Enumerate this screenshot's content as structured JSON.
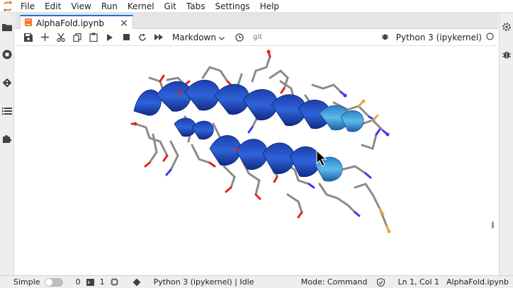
{
  "menu": {
    "items": [
      "File",
      "Edit",
      "View",
      "Run",
      "Kernel",
      "Git",
      "Tabs",
      "Settings",
      "Help"
    ]
  },
  "tab": {
    "title": "AlphaFold.ipynb",
    "close": "×"
  },
  "toolbar": {
    "cell_type": "Markdown",
    "git_label": "git",
    "kernel_name": "Python 3 (ipykernel)"
  },
  "statusbar": {
    "mode_label": "Simple",
    "terminals_count": "0",
    "kernels_count": "1",
    "kernel_status": "Python 3 (ipykernel) | Idle",
    "mode": "Mode: Command",
    "position": "Ln 1, Col 1",
    "filename": "AlphaFold.ipynb"
  },
  "colors": {
    "accent": "#1976d2",
    "helix_dark": "#1a3fa8",
    "helix_light": "#4aa8e0",
    "stick_gray": "#8c8c8c",
    "oxygen": "#e32222",
    "nitrogen": "#3a3af0",
    "sulfur": "#e8a640"
  },
  "icons": {
    "logo": "jupyter-logo-icon",
    "folder": "folder-icon",
    "stop": "running-stop-icon",
    "git": "git-diamond-icon",
    "toc": "table-of-contents-icon",
    "extension": "puzzle-icon",
    "settings": "gear-icon",
    "debugger": "bug-icon"
  }
}
